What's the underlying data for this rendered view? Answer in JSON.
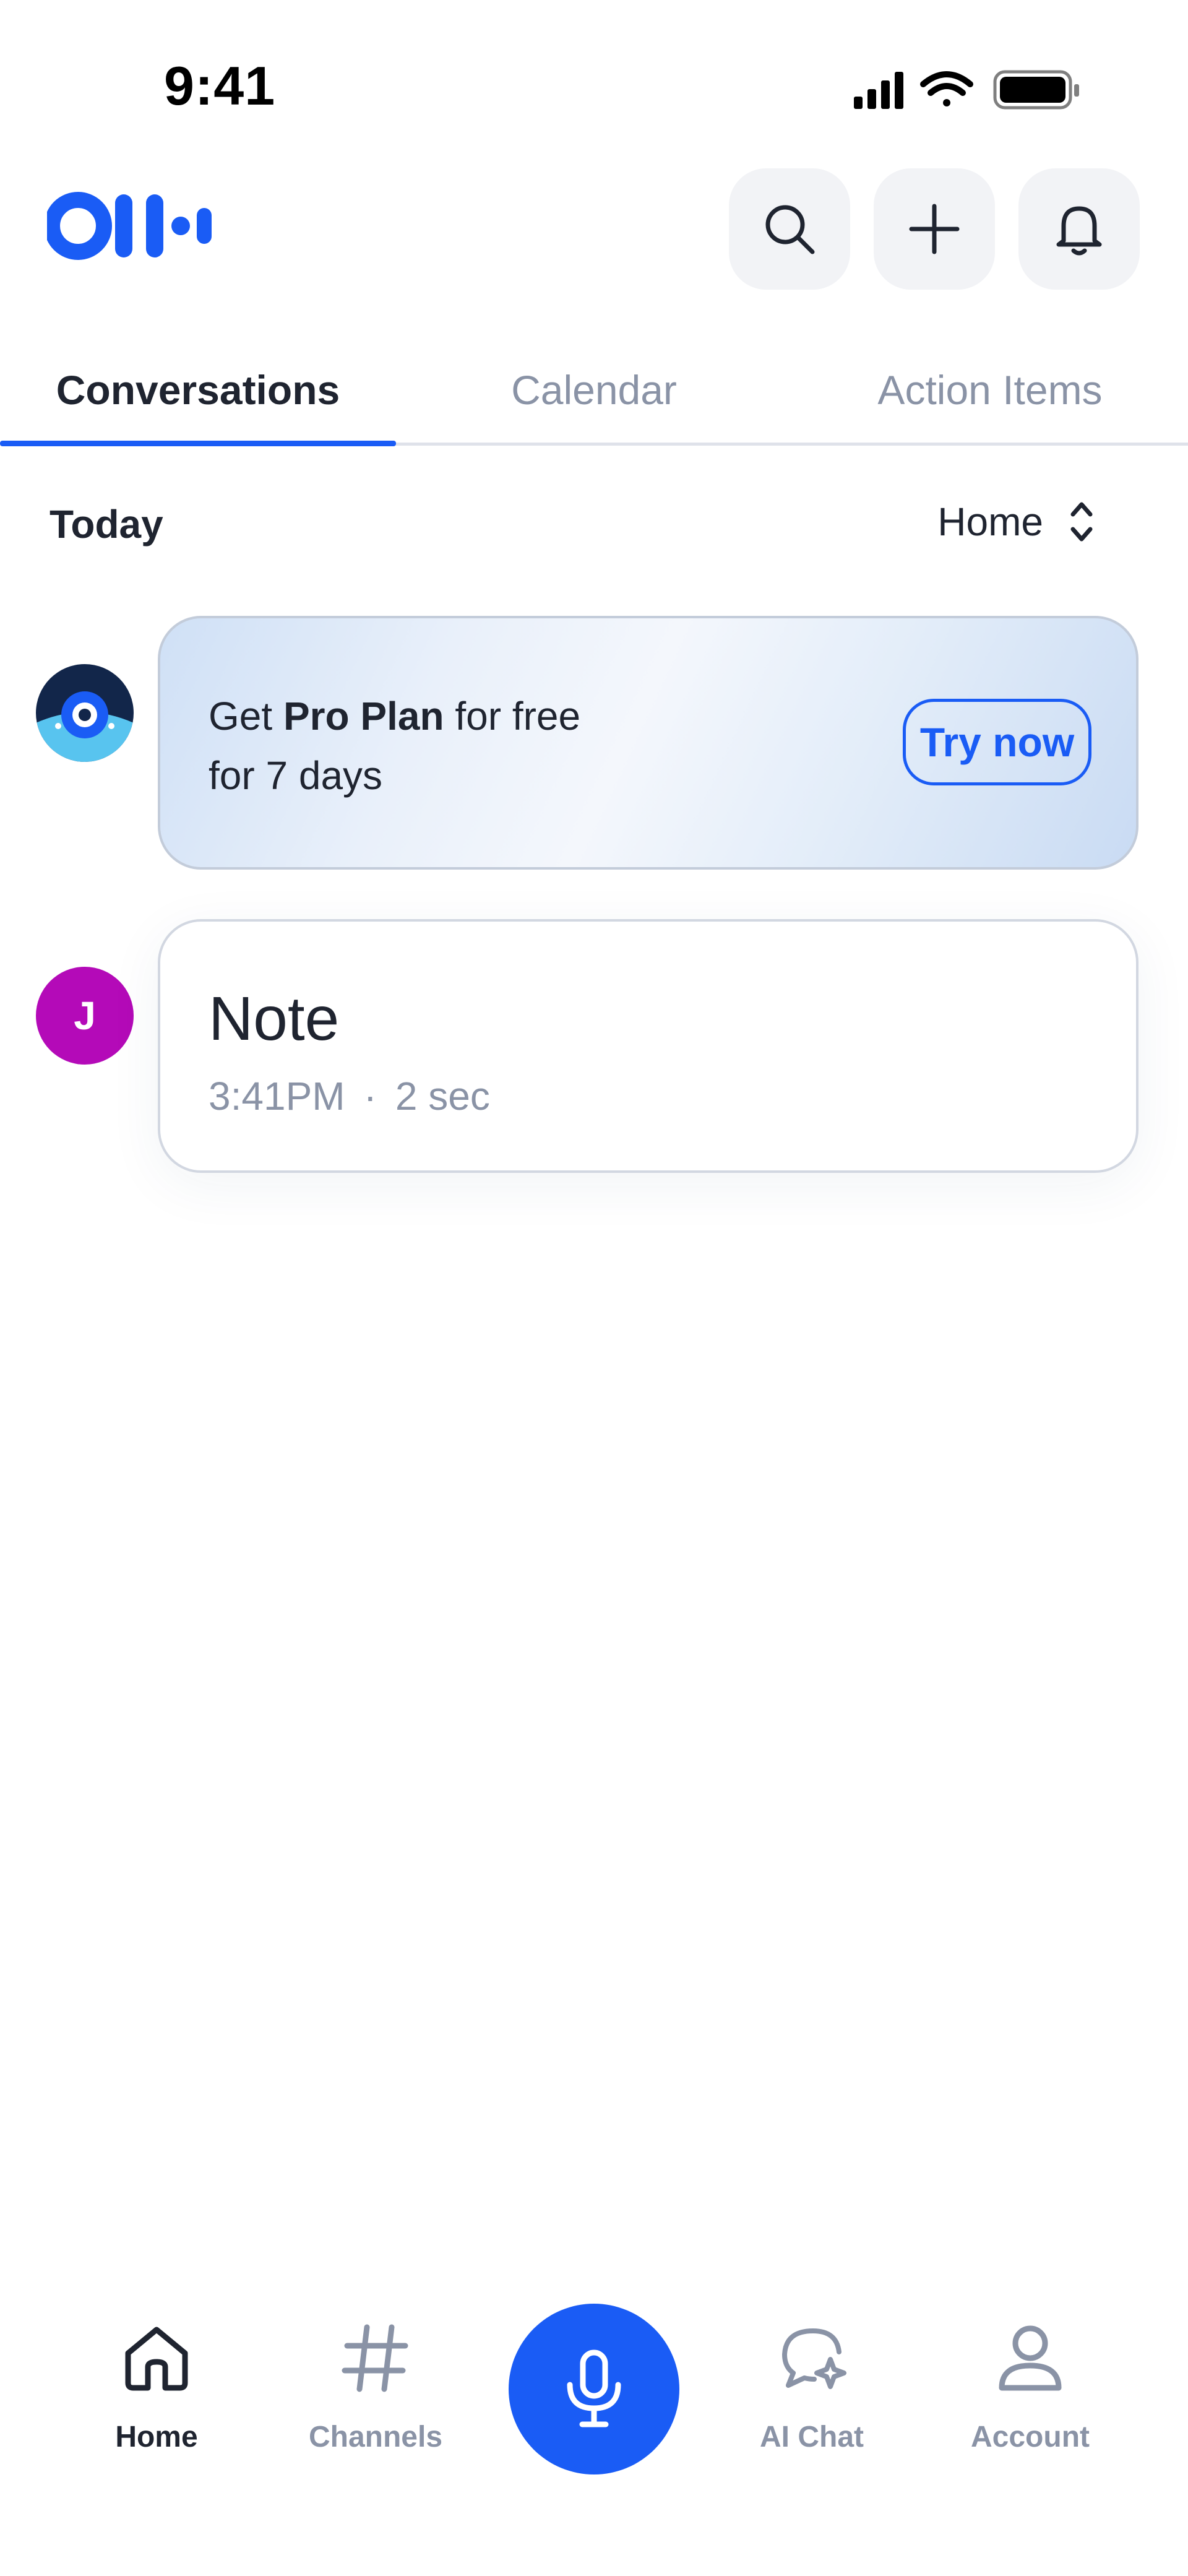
{
  "status_bar": {
    "time": "9:41"
  },
  "colors": {
    "accent": "#1a5cf5",
    "avatar_j": "#b40ab8",
    "muted": "#8a93a6",
    "text": "#1f2430"
  },
  "header": {
    "logo": "otter-logo",
    "buttons": [
      {
        "icon": "search-icon"
      },
      {
        "icon": "plus-icon"
      },
      {
        "icon": "bell-icon"
      }
    ]
  },
  "tabs": [
    {
      "label": "Conversations",
      "active": true
    },
    {
      "label": "Calendar",
      "active": false
    },
    {
      "label": "Action Items",
      "active": false
    }
  ],
  "section": {
    "title": "Today",
    "filter": "Home"
  },
  "promo": {
    "prefix": "Get ",
    "bold": "Pro Plan",
    "suffix": " for free",
    "line2": "for 7 days",
    "button": "Try now"
  },
  "notes": [
    {
      "avatar_initial": "J",
      "title": "Note",
      "time": "3:41PM",
      "separator": "·",
      "duration": "2 sec"
    }
  ],
  "bottom_nav": [
    {
      "label": "Home",
      "icon": "home-icon",
      "active": true
    },
    {
      "label": "Channels",
      "icon": "hash-icon",
      "active": false
    },
    {
      "label": "AI Chat",
      "icon": "ai-chat-icon",
      "active": false
    },
    {
      "label": "Account",
      "icon": "account-icon",
      "active": false
    }
  ],
  "record_button": {
    "icon": "microphone-icon"
  }
}
